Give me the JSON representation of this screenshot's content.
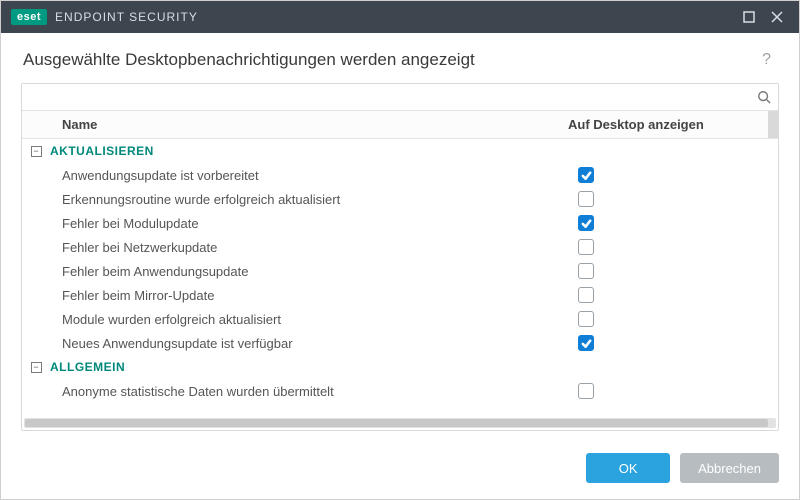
{
  "titlebar": {
    "brand_badge": "eset",
    "brand_name": "ENDPOINT SECURITY"
  },
  "header": {
    "title": "Ausgewählte Desktopbenachrichtigungen werden angezeigt"
  },
  "search": {
    "placeholder": ""
  },
  "columns": {
    "name": "Name",
    "show": "Auf Desktop anzeigen"
  },
  "groups": [
    {
      "key": "aktualisieren",
      "label": "AKTUALISIEREN",
      "expanded": true,
      "items": [
        {
          "name": "Anwendungsupdate ist vorbereitet",
          "checked": true
        },
        {
          "name": "Erkennungsroutine wurde erfolgreich aktualisiert",
          "checked": false
        },
        {
          "name": "Fehler bei Modulupdate",
          "checked": true
        },
        {
          "name": "Fehler bei Netzwerkupdate",
          "checked": false
        },
        {
          "name": "Fehler beim Anwendungsupdate",
          "checked": false
        },
        {
          "name": "Fehler beim Mirror-Update",
          "checked": false
        },
        {
          "name": "Module wurden erfolgreich aktualisiert",
          "checked": false
        },
        {
          "name": "Neues Anwendungsupdate ist verfügbar",
          "checked": true
        }
      ]
    },
    {
      "key": "allgemein",
      "label": "ALLGEMEIN",
      "expanded": true,
      "items": [
        {
          "name": "Anonyme statistische Daten wurden übermittelt",
          "checked": false
        }
      ]
    }
  ],
  "buttons": {
    "ok": "OK",
    "cancel": "Abbrechen"
  },
  "colors": {
    "accent_teal": "#009982",
    "accent_blue": "#0f7ed6",
    "button_primary": "#2aa3df",
    "button_secondary": "#b7bcc0",
    "titlebar_bg": "#3d464f"
  }
}
